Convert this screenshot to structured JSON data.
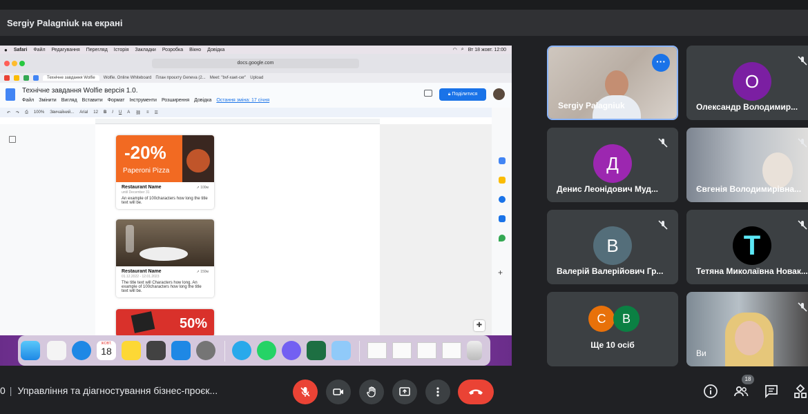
{
  "share_header": {
    "presenter_label": "Sergiy Palagniuk на екрані"
  },
  "shared_screen": {
    "mac_menubar": {
      "items": [
        "Safari",
        "Файл",
        "Редагування",
        "Перегляд",
        "Історія",
        "Закладки",
        "Розробка",
        "Вікно",
        "Довідка"
      ],
      "clock": "Вт 18 жовт. 12:00"
    },
    "browser": {
      "url": "docs.google.com",
      "tabs": [
        "Технічне завдання Wolfie",
        "Wolfie. Online Whiteboard",
        "План проєкту Geneva (2...",
        "Meet: \"bvf-xaet-cer\"",
        "Upload"
      ]
    },
    "docs": {
      "title": "Технічне завдання Wolfie версія 1.0.",
      "menu": [
        "Файл",
        "Змінити",
        "Вигляд",
        "Вставити",
        "Формат",
        "Інструменти",
        "Розширення",
        "Довідка"
      ],
      "last_edit": "Остання зміна: 17 січня",
      "share_button": "Поділитися",
      "toolbar": {
        "zoom": "100%",
        "style": "Звичайний...",
        "font": "Arial",
        "size": "12"
      }
    },
    "cards": [
      {
        "promo_percent": "-20%",
        "promo_name": "Paperoni Pizza",
        "restaurant_name": "Restaurant Name",
        "distance": "100м",
        "subtitle": "until December 31",
        "text": "An example of 100characters how long the title text will be."
      },
      {
        "restaurant_name": "Restaurant Name",
        "distance": "150м",
        "subtitle": "01.12.2022 - 12.01.2023",
        "text": "The title text will Characters how long. An example of 100characters how long the title text will be."
      },
      {
        "promo_percent": "50%"
      }
    ],
    "dock": {
      "calendar_month": "ЖОВТ.",
      "calendar_day": "18"
    }
  },
  "participants": [
    {
      "name": "Sergiy Palagniuk",
      "type": "video",
      "active": true
    },
    {
      "name": "Олександр Володимир...",
      "initial": "О",
      "color": "#7b1fa2",
      "muted": true
    },
    {
      "name": "Денис Леонідович Муд...",
      "initial": "Д",
      "color": "#9c27b0",
      "muted": true
    },
    {
      "name": "Євгенія Володимирівна...",
      "type": "video",
      "muted": true
    },
    {
      "name": "Валерій Валерійович Гр...",
      "initial": "В",
      "color": "#546e7a",
      "muted": true
    },
    {
      "name": "Тетяна Миколаївна Новак...",
      "initial": "Т",
      "color": "#000000",
      "muted": true
    },
    {
      "name": "Ще 10 осіб",
      "type": "more",
      "circles": [
        {
          "initial": "С",
          "color": "#e8710a"
        },
        {
          "initial": "В",
          "color": "#0b8043"
        }
      ]
    },
    {
      "name": "Ви",
      "type": "video",
      "muted": true
    }
  ],
  "bottom_bar": {
    "time_fragment": "0",
    "meeting_title": "Управління та діагностування бізнес-проєк...",
    "participant_count": "18"
  }
}
